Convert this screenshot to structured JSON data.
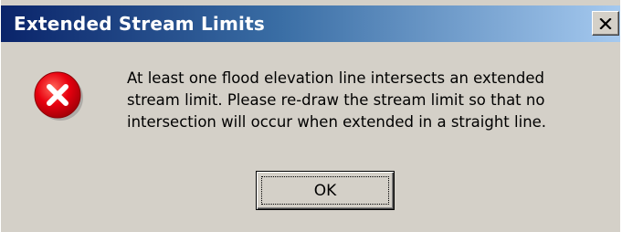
{
  "window": {
    "title": "Extended Stream Limits",
    "close_icon": "close-x-icon",
    "title_gradient": [
      "#0a246a",
      "#a6caf0"
    ]
  },
  "icon": {
    "name": "error-icon",
    "color": "#e8000f"
  },
  "message": {
    "text": "At least one flood elevation line intersects an extended\nstream limit.  Please re-draw the stream limit so that no\nintersection will occur when extended in a straight line."
  },
  "buttons": {
    "ok_label": "OK"
  },
  "colors": {
    "dialog_background": "#d4d0c8",
    "title_text": "#ffffff"
  }
}
